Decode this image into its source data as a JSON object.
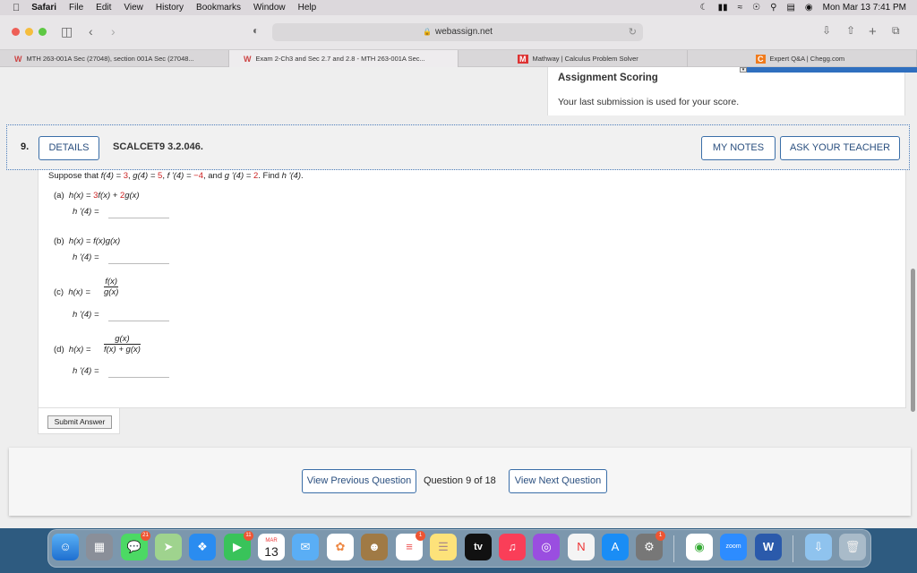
{
  "menubar": {
    "apple": "",
    "items": [
      "Safari",
      "File",
      "Edit",
      "View",
      "History",
      "Bookmarks",
      "Window",
      "Help"
    ],
    "clock": "Mon Mar 13  7:41 PM"
  },
  "browser": {
    "url": "webassign.net",
    "tabs": [
      {
        "icon": "W",
        "label": "MTH 263-001A Sec (27048), section 001A Sec (27048..."
      },
      {
        "icon": "W",
        "label": "Exam 2-Ch3 and Sec 2.7 and 2.8 - MTH 263-001A Sec..."
      },
      {
        "icon": "M",
        "label": "Mathway | Calculus Problem Solver"
      },
      {
        "icon": "C",
        "label": "Expert Q&A | Chegg.com"
      }
    ]
  },
  "assignment_scoring": {
    "title": "Assignment Scoring",
    "body": "Your last submission is used for your score."
  },
  "question": {
    "number": "9.",
    "details_label": "DETAILS",
    "code": "SCALCET9 3.2.046.",
    "my_notes_label": "MY NOTES",
    "ask_teacher_label": "ASK YOUR TEACHER",
    "prompt_parts": [
      "Suppose that ",
      "f(4) = ",
      "3",
      ", ",
      "g(4) = ",
      "5",
      ", ",
      "f '(4) = ",
      "−4",
      ", and ",
      "g '(4) = ",
      "2",
      ". Find ",
      "h '(4)",
      "."
    ],
    "answer_label": "h '(4) =",
    "parts": [
      {
        "label": "(a)",
        "expr_pre": "h(x) = ",
        "coef1": "3",
        "mid": "f(x) + ",
        "coef2": "2",
        "post": "g(x)"
      },
      {
        "label": "(b)",
        "expr": "h(x) = f(x)g(x)"
      },
      {
        "label": "(c)",
        "lhs": "h(x) =",
        "num": "f(x)",
        "den": "g(x)"
      },
      {
        "label": "(d)",
        "lhs": "h(x) =",
        "num": "g(x)",
        "den": "f(x) + g(x)"
      }
    ],
    "submit_label": "Submit Answer"
  },
  "navigation": {
    "prev_label": "View Previous Question",
    "count": "Question 9 of 18",
    "next_label": "View Next Question"
  },
  "dock": {
    "calendar_month": "MAR",
    "calendar_day": "13",
    "badges": {
      "messages": "21",
      "facetime": "11",
      "reminders": "1",
      "settings": "1"
    },
    "tv_label": "tv",
    "zoom_label": "zoom",
    "word_label": "W"
  },
  "colors": {
    "accent": "#3a6ea8",
    "given_values": "#cc2222"
  }
}
